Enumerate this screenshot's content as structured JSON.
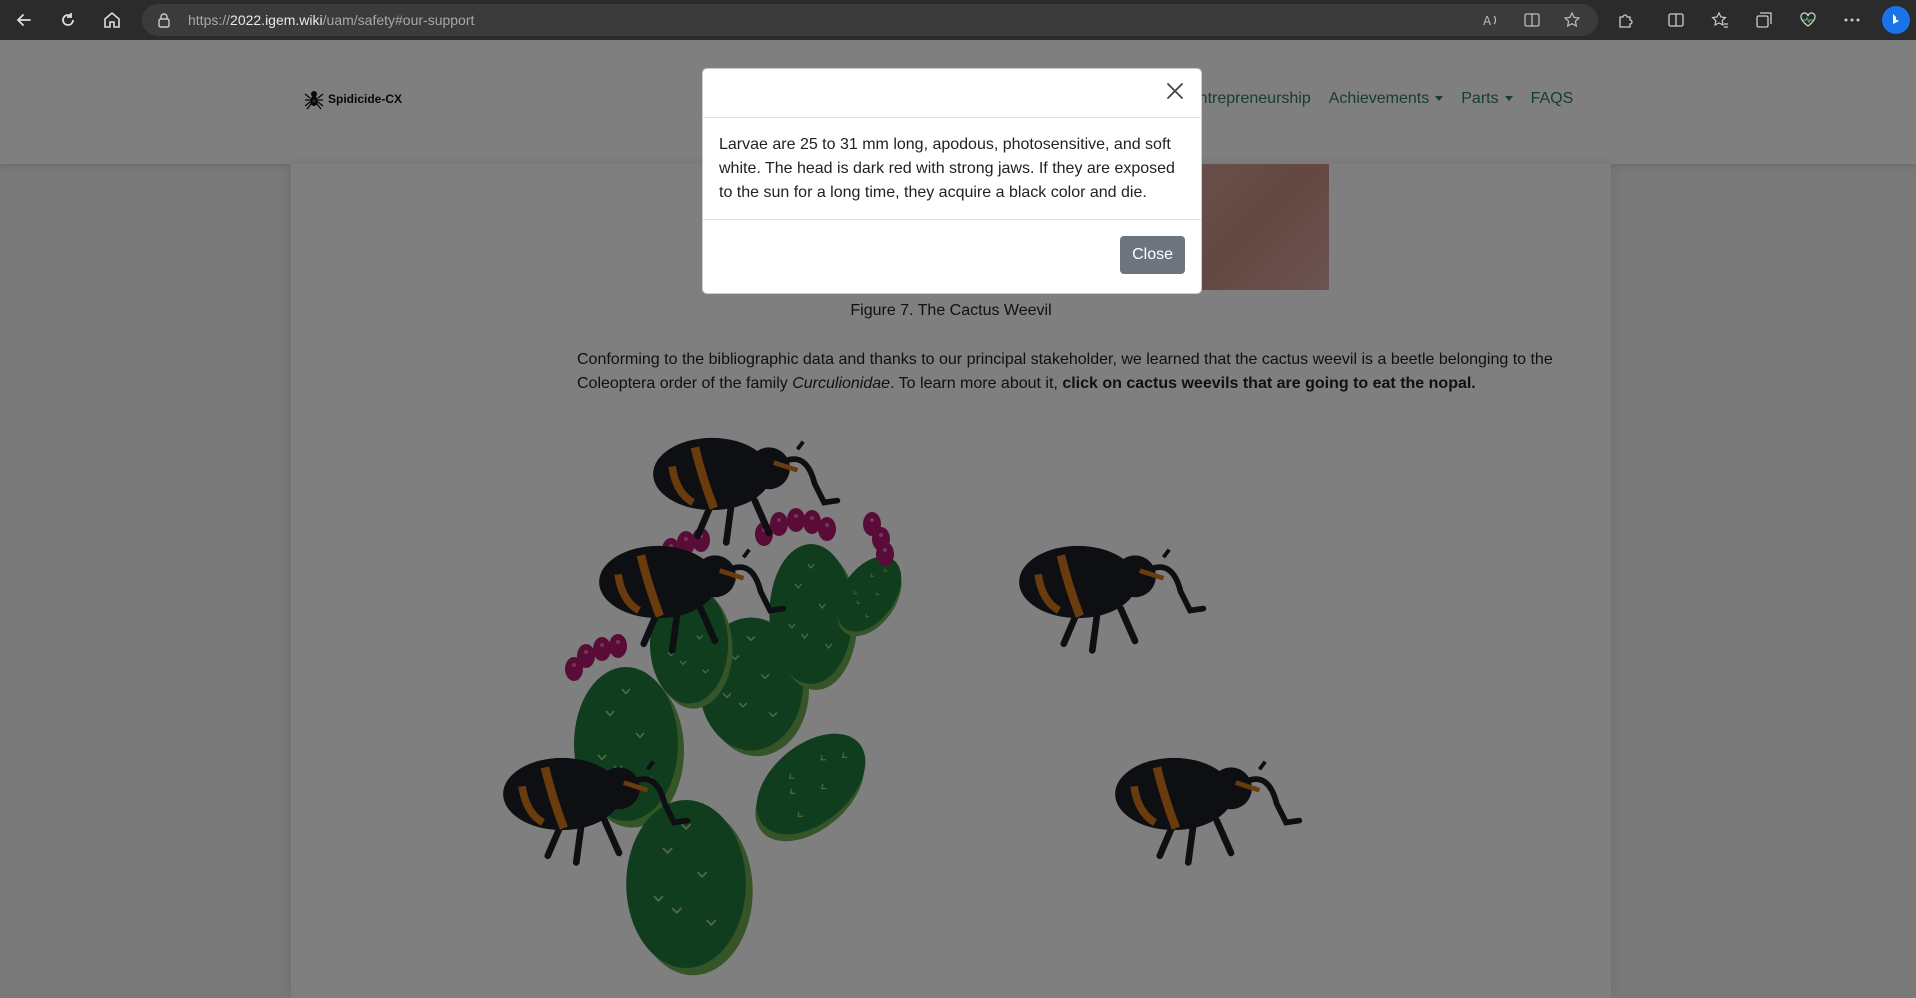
{
  "browser": {
    "url_prefix": "https://",
    "url_domain": "2022.igem.wiki",
    "url_path": "/uam/safety#our-support",
    "icons": [
      "back-icon",
      "refresh-icon",
      "home-icon",
      "lock-icon",
      "read-aloud-icon",
      "immersive-reader-icon",
      "favorite-star-icon",
      "extensions-icon",
      "split-screen-icon",
      "favorites-icon",
      "collections-icon",
      "browser-essentials-icon",
      "more-icon",
      "bing-icon"
    ]
  },
  "navbar": {
    "brand": "Spidicide-CX",
    "links": [
      {
        "label": "Entrepreneurship",
        "dropdown": false
      },
      {
        "label": "Achievements",
        "dropdown": true
      },
      {
        "label": "Parts",
        "dropdown": true
      },
      {
        "label": "FAQS",
        "dropdown": false
      }
    ]
  },
  "content": {
    "figure_caption": "Figure 7. The Cactus Weevil",
    "paragraph_part1": "Conforming to the bibliographic data and thanks to our principal stakeholder, we learned that the cactus weevil is a beetle belonging to the Coleoptera order of the family ",
    "paragraph_family": "Curculionidae",
    "paragraph_part2": ". To learn more about it, ",
    "paragraph_bold": "click on cactus weevils that are going to eat the nopal."
  },
  "modal": {
    "body": "Larvae are 25 to 31 mm long, apodous, photosensitive, and soft white. The head is dark red with strong jaws. If they are exposed to the sun for a long time, they acquire a black color and die.",
    "close_label": "Close"
  },
  "colors": {
    "nav_link": "#2e7d55",
    "close_button": "#6c757d",
    "cactus": "#1e7a3a",
    "cactus_shadow": "#6aa84f",
    "fruit": "#b0186e",
    "weevil_body": "#1c1f26",
    "weevil_band": "#d4781a"
  }
}
